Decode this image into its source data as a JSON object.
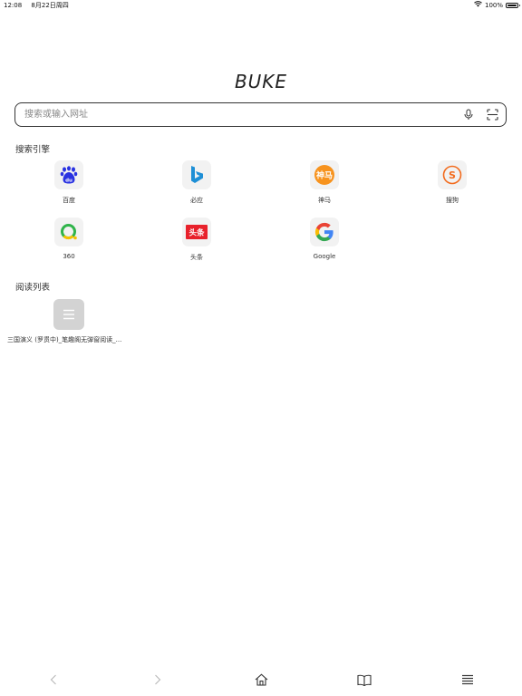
{
  "status_bar": {
    "time": "12:08",
    "date": "8月22日周四",
    "battery_text": "100%",
    "battery_level": 1.0
  },
  "brand": {
    "title": "BUKE"
  },
  "search": {
    "placeholder": "搜索或输入网址"
  },
  "engines_section": {
    "title": "搜索引擎",
    "items": [
      {
        "label": "百度",
        "icon": "baidu-icon"
      },
      {
        "label": "必应",
        "icon": "bing-icon"
      },
      {
        "label": "神马",
        "icon": "shenma-icon"
      },
      {
        "label": "搜狗",
        "icon": "sogou-icon"
      },
      {
        "label": "360",
        "icon": "360-icon"
      },
      {
        "label": "头条",
        "icon": "toutiao-icon"
      },
      {
        "label": "Google",
        "icon": "google-icon"
      }
    ]
  },
  "reading_section": {
    "title": "阅读列表",
    "items": [
      {
        "label": "三国演义 (罗贯中)_笔趣阁无弹窗阅读_...",
        "icon": "list-icon"
      }
    ]
  },
  "toolbar": {
    "items": [
      "back-icon",
      "forward-icon",
      "home-icon",
      "book-icon",
      "menu-icon"
    ]
  },
  "colors": {
    "baidu": "#2932e1",
    "bing": "#1e8fd6",
    "shenma": "#f7931e",
    "sogou": "#f26b1d",
    "qihoo": "#2fb44a",
    "toutiao": "#e8212b"
  }
}
